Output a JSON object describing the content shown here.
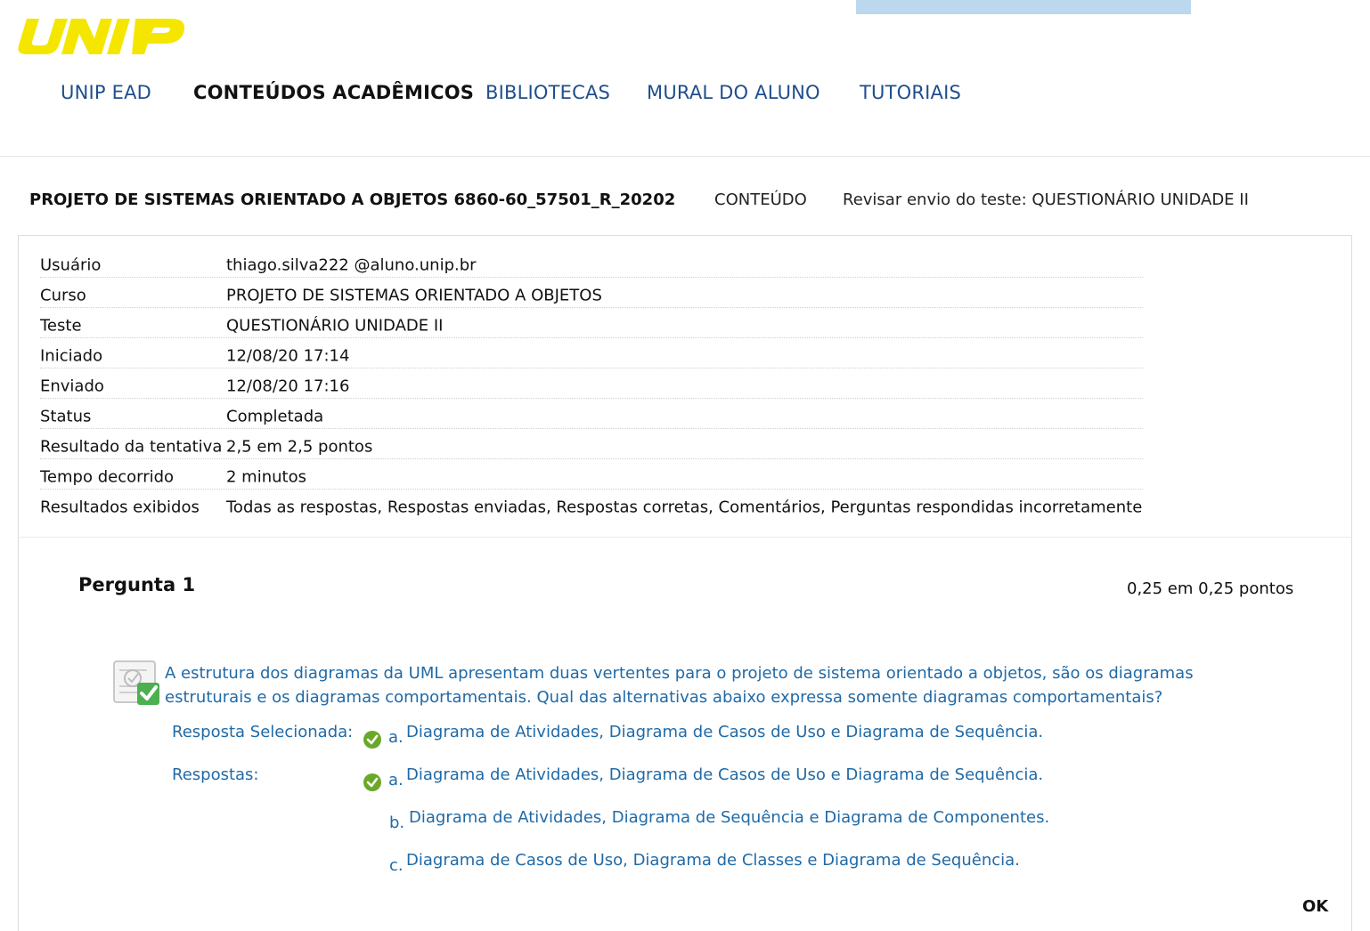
{
  "header": {
    "logo_text": "UNIP",
    "brand_color": "#f5e600"
  },
  "nav": {
    "items": [
      {
        "label": "UNIP EAD"
      },
      {
        "label": "CONTEÚDOS ACADÊMICOS"
      },
      {
        "label": "BIBLIOTECAS"
      },
      {
        "label": "MURAL DO ALUNO"
      },
      {
        "label": "TUTORIAIS"
      }
    ],
    "active_index": 1
  },
  "breadcrumb": {
    "course": "PROJETO DE SISTEMAS ORIENTADO A OBJETOS 6860-60_57501_R_20202",
    "content": "CONTEÚDO",
    "page": "Revisar envio do teste: QUESTIONÁRIO UNIDADE II"
  },
  "info": [
    {
      "label": "Usuário",
      "value": "thiago.silva222 @aluno.unip.br"
    },
    {
      "label": "Curso",
      "value": "PROJETO DE SISTEMAS ORIENTADO A OBJETOS"
    },
    {
      "label": "Teste",
      "value": "QUESTIONÁRIO UNIDADE II"
    },
    {
      "label": "Iniciado",
      "value": "12/08/20 17:14"
    },
    {
      "label": "Enviado",
      "value": "12/08/20 17:16"
    },
    {
      "label": "Status",
      "value": "Completada"
    },
    {
      "label": "Resultado da tentativa",
      "value": "2,5 em 2,5 pontos"
    },
    {
      "label": "Tempo decorrido",
      "value": "2 minutos"
    },
    {
      "label": "Resultados exibidos",
      "value": "Todas as respostas, Respostas enviadas, Respostas corretas, Comentários, Perguntas respondidas incorretamente"
    }
  ],
  "question": {
    "title": "Pergunta 1",
    "points": "0,25 em 0,25 pontos",
    "text": "A estrutura dos diagramas da UML apresentam duas vertentes para o projeto de sistema orientado a objetos, são os diagramas estruturais e os diagramas comportamentais. Qual das alternativas abaixo expressa somente diagramas comportamentais?",
    "selected_label": "Resposta Selecionada:",
    "answers_label": "Respostas:",
    "selected": {
      "letter": "a.",
      "text": "Diagrama de Atividades, Diagrama de Casos de Uso e Diagrama de Sequência."
    },
    "answers": [
      {
        "letter": "a.",
        "text": "Diagrama de Atividades, Diagrama de Casos de Uso e Diagrama de Sequência."
      },
      {
        "letter": "b.",
        "text": "Diagrama de Atividades, Diagrama de Sequência e Diagrama de Componentes."
      },
      {
        "letter": "c.",
        "text": "Diagrama de Casos de Uso, Diagrama de Classes e Diagrama de Sequência."
      }
    ],
    "correct_color": "#6aa82a"
  },
  "footer": {
    "ok_label": "OK"
  }
}
